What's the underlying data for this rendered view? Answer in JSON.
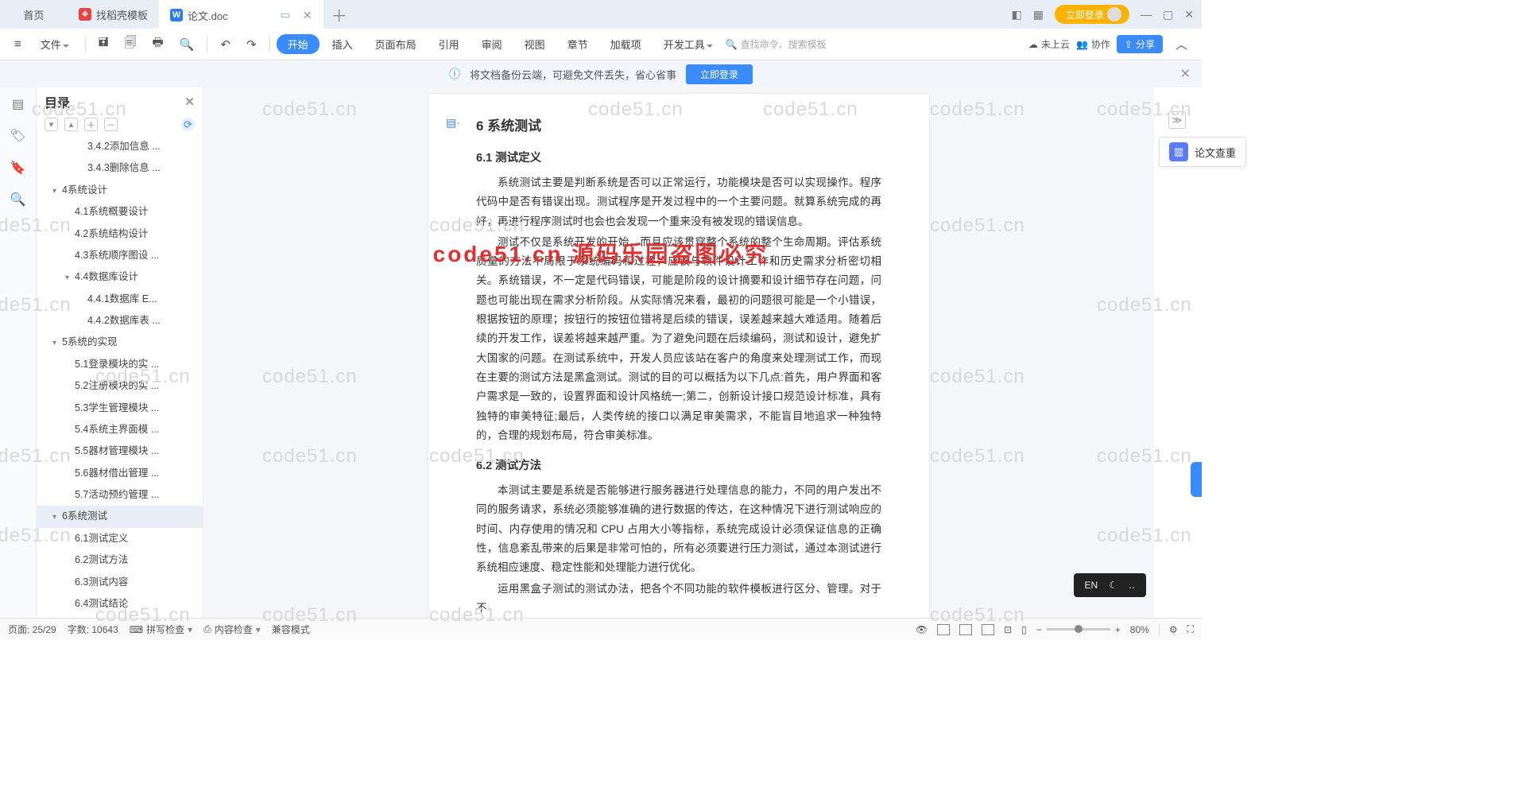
{
  "tabs": {
    "home": "首页",
    "template": "找稻壳模板",
    "doc": "论文.doc"
  },
  "titlebar": {
    "grid_icon": "⊞",
    "apps_icon": "⊡",
    "login_pill": "立即登录",
    "min": "—",
    "max": "▢",
    "close": "✕"
  },
  "toolbar": {
    "file": "文件",
    "start": "开始",
    "insert": "插入",
    "layout": "页面布局",
    "ref": "引用",
    "review": "审阅",
    "view": "视图",
    "chapter": "章节",
    "addin": "加载项",
    "dev": "开发工具",
    "search_placeholder": "查找命令、搜索模板",
    "not_cloud": "未上云",
    "collab": "协作",
    "share": "分享"
  },
  "banner": {
    "text": "将文档备份云端，可避免文件丢失，省心省事",
    "btn": "立即登录"
  },
  "outline": {
    "title": "目录",
    "items": [
      {
        "lvl": 3,
        "text": "3.4.2添加信息 ..."
      },
      {
        "lvl": 3,
        "text": "3.4.3删除信息 ..."
      },
      {
        "lvl": 1,
        "text": "4系统设计",
        "caret": true
      },
      {
        "lvl": 2,
        "text": "4.1系统概要设计"
      },
      {
        "lvl": 2,
        "text": "4.2系统结构设计"
      },
      {
        "lvl": 2,
        "text": "4.3系统顺序图设 ..."
      },
      {
        "lvl": 2,
        "text": "4.4数据库设计",
        "caret": true
      },
      {
        "lvl": 3,
        "text": "4.4.1数据库 E..."
      },
      {
        "lvl": 3,
        "text": "4.4.2数据库表 ..."
      },
      {
        "lvl": 1,
        "text": "5系统的实现",
        "caret": true
      },
      {
        "lvl": 2,
        "text": "5.1登录模块的实 ..."
      },
      {
        "lvl": 2,
        "text": "5.2注册模块的实 ..."
      },
      {
        "lvl": 2,
        "text": "5.3学生管理模块 ..."
      },
      {
        "lvl": 2,
        "text": "5.4系统主界面模 ..."
      },
      {
        "lvl": 2,
        "text": "5.5器材管理模块 ..."
      },
      {
        "lvl": 2,
        "text": "5.6器材借出管理 ..."
      },
      {
        "lvl": 2,
        "text": "5.7活动预约管理 ..."
      },
      {
        "lvl": 1,
        "text": "6系统测试",
        "active": true,
        "caret": true
      },
      {
        "lvl": 2,
        "text": "6.1测试定义"
      },
      {
        "lvl": 2,
        "text": "6.2测试方法"
      },
      {
        "lvl": 2,
        "text": "6.3测试内容"
      },
      {
        "lvl": 2,
        "text": "6.4测试结论"
      }
    ]
  },
  "doc": {
    "h6": "6  系统测试",
    "h61": "6.1  测试定义",
    "p1": "系统测试主要是判断系统是否可以正常运行，功能模块是否可以实现操作。程序代码中是否有错误出现。测试程序是开发过程中的一个主要问题。就算系统完成的再好，再进行程序测试时也会也会发现一个重来没有被发现的错误信息。",
    "p2": "测试不仅是系统开发的开始，而且应该贯穿整个系统的整个生命周期。评估系统质量的方法不局限于系统编码和过程，应该与软件设计工作和历史需求分析密切相关。系统错误，不一定是代码错误，可能是阶段的设计摘要和设计细节存在问题，问题也可能出现在需求分析阶段。从实际情况来看，最初的问题很可能是一个小错误，根据按钮的原理；按钮行的按钮位错将是后续的错误，误差越来越大难适用。随着后续的开发工作，误差将越来越严重。为了避免问题在后续编码，测试和设计，避免扩大国家的问题。在测试系统中，开发人员应该站在客户的角度来处理测试工作，而现在主要的测试方法是黑盒测试。测试的目的可以概括为以下几点:首先，用户界面和客户需求是一致的，设置界面和设计风格统一;第二，创新设计接口规范设计标准，具有独特的审美特征;最后，人类传统的接口以满足审美需求，不能盲目地追求一种独特的，合理的规划布局，符合审美标准。",
    "h62": "6.2  测试方法",
    "p3": "本测试主要是系统是否能够进行服务器进行处理信息的能力，不同的用户发出不同的服务请求，系统必须能够准确的进行数据的传达，在这种情况下进行测试响应的时间、内存使用的情况和 CPU 占用大小等指标，系统完成设计必须保证信息的正确性，信息紊乱带来的后果是非常可怕的，所有必须要进行压力测试，通过本测试进行系统相应速度、稳定性能和处理能力进行优化。",
    "p4": "运用黑盒子测试的测试办法，把各个不同功能的软件模板进行区分、管理。对于不"
  },
  "right": {
    "check_dup": "论文查重"
  },
  "watermark_red": "code51.cn 源码乐园盗图必究",
  "watermark_grey": "code51.cn",
  "ime": {
    "lang": "EN",
    "moon": "☾",
    "dots": "‥"
  },
  "status": {
    "page": "页面: 25/29",
    "words": "字数: 10643",
    "spell": "拼写检查",
    "content": "内容检查",
    "compat": "兼容模式",
    "zoom": "80%"
  }
}
